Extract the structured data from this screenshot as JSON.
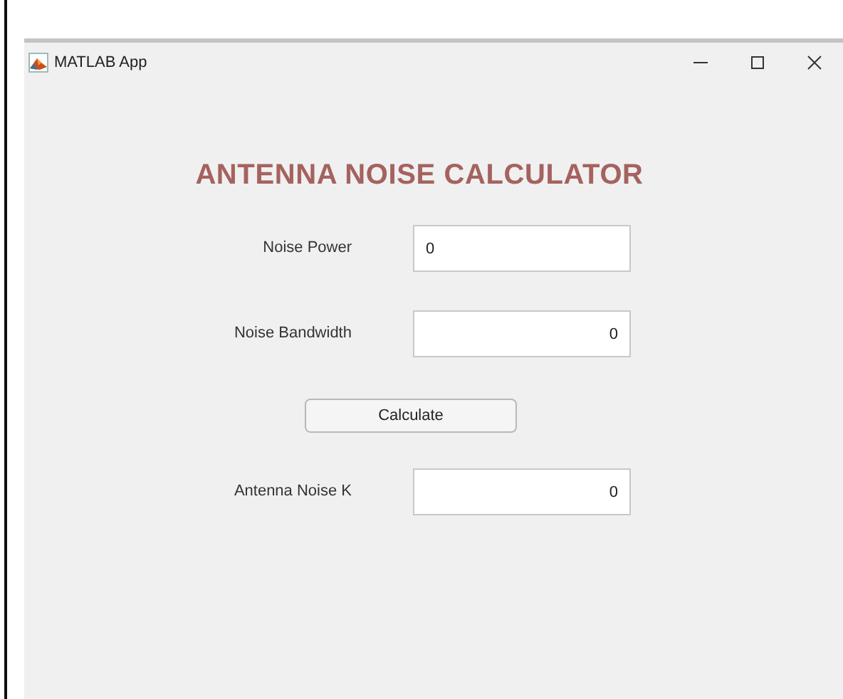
{
  "window": {
    "title": "MATLAB App",
    "controls": [
      {
        "kind": "minimize"
      },
      {
        "kind": "maximize"
      },
      {
        "kind": "close"
      }
    ]
  },
  "heading": "ANTENNA NOISE CALCULATOR",
  "fields": [
    {
      "label": "Noise Power",
      "value": "0",
      "right_aligned": false
    },
    {
      "label": "Noise Bandwidth",
      "value": "0",
      "right_aligned": true
    }
  ],
  "button": "Calculate",
  "output": {
    "label": "Antenna Noise K",
    "value": "0",
    "right_aligned": true
  }
}
